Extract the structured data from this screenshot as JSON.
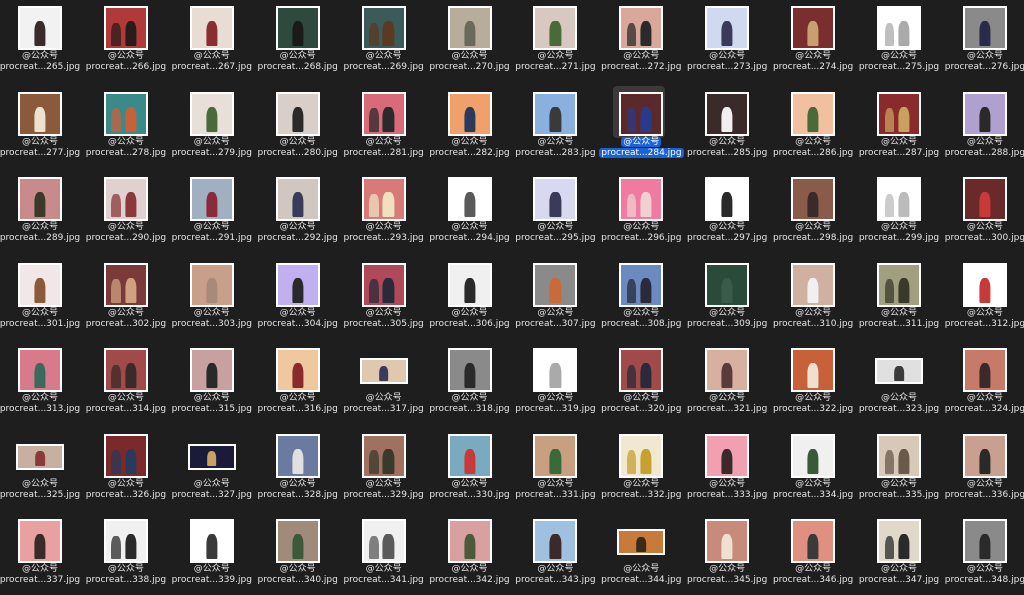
{
  "account_label": "@公众号",
  "colors": {
    "background": "#1e1e1e",
    "selection": "#1a63d6",
    "text": "#e6e6e6"
  },
  "files": [
    {
      "caption": "procreat...265.jpg",
      "bg": "#f2f2f2",
      "fig": "#3a2b2b"
    },
    {
      "caption": "procreat...266.jpg",
      "bg": "#b03a3a",
      "fig": "#2a1c18"
    },
    {
      "caption": "procreat...267.jpg",
      "bg": "#e8dcd3",
      "fig": "#8a2f2f"
    },
    {
      "caption": "procreat...268.jpg",
      "bg": "#2e4a3e",
      "fig": "#1a1a1a"
    },
    {
      "caption": "procreat...269.jpg",
      "bg": "#3d5a5a",
      "fig": "#5a3a22"
    },
    {
      "caption": "procreat...270.jpg",
      "bg": "#b8ad9a",
      "fig": "#6a6a5a"
    },
    {
      "caption": "procreat...271.jpg",
      "bg": "#d8c8c0",
      "fig": "#4a6a3a"
    },
    {
      "caption": "procreat...272.jpg",
      "bg": "#d9a89a",
      "fig": "#2a2a2a"
    },
    {
      "caption": "procreat...273.jpg",
      "bg": "#cfdaf0",
      "fig": "#3a3a5a"
    },
    {
      "caption": "procreat...274.jpg",
      "bg": "#7a2e2e",
      "fig": "#c8a070"
    },
    {
      "caption": "procreat...275.jpg",
      "bg": "#ffffff",
      "fig": "#aaaaaa"
    },
    {
      "caption": "procreat...276.jpg",
      "bg": "#8a8a8a",
      "fig": "#2a2a4a"
    },
    {
      "caption": "procreat...277.jpg",
      "bg": "#8a5a3a",
      "fig": "#f0e0d0"
    },
    {
      "caption": "procreat...278.jpg",
      "bg": "#3a8a8a",
      "fig": "#c8603a"
    },
    {
      "caption": "procreat...279.jpg",
      "bg": "#e8e0d8",
      "fig": "#4a6a3a"
    },
    {
      "caption": "procreat...280.jpg",
      "bg": "#d8d0c8",
      "fig": "#2a2a2a"
    },
    {
      "caption": "procreat...281.jpg",
      "bg": "#d86a7a",
      "fig": "#2a2a2a"
    },
    {
      "caption": "procreat...282.jpg",
      "bg": "#f0a06a",
      "fig": "#2a3a5a"
    },
    {
      "caption": "procreat...283.jpg",
      "bg": "#8ab0e0",
      "fig": "#3a3a3a"
    },
    {
      "caption": "procreat...284.jpg",
      "bg": "#5a2a2a",
      "fig": "#2a3a8a"
    },
    {
      "caption": "procreat...285.jpg",
      "bg": "#3a2a2a",
      "fig": "#f0f0f0"
    },
    {
      "caption": "procreat...286.jpg",
      "bg": "#f0c0a0",
      "fig": "#4a6a3a"
    },
    {
      "caption": "procreat...287.jpg",
      "bg": "#8a2a2a",
      "fig": "#c8a060"
    },
    {
      "caption": "procreat...288.jpg",
      "bg": "#b0a0d0",
      "fig": "#2a2a2a"
    },
    {
      "caption": "procreat...289.jpg",
      "bg": "#c88a8a",
      "fig": "#3a3a2a"
    },
    {
      "caption": "procreat...290.jpg",
      "bg": "#e0d0d0",
      "fig": "#8a3a3a"
    },
    {
      "caption": "procreat...291.jpg",
      "bg": "#a0b0c0",
      "fig": "#8a2a3a"
    },
    {
      "caption": "procreat...292.jpg",
      "bg": "#d0c8c0",
      "fig": "#3a3a5a"
    },
    {
      "caption": "procreat...293.jpg",
      "bg": "#d87a7a",
      "fig": "#f0e0c0"
    },
    {
      "caption": "procreat...294.jpg",
      "bg": "#ffffff",
      "fig": "#5a5a5a"
    },
    {
      "caption": "procreat...295.jpg",
      "bg": "#d8d8f0",
      "fig": "#3a3a5a"
    },
    {
      "caption": "procreat...296.jpg",
      "bg": "#f07aa0",
      "fig": "#f0d0d0"
    },
    {
      "caption": "procreat...297.jpg",
      "bg": "#ffffff",
      "fig": "#2a2a2a"
    },
    {
      "caption": "procreat...298.jpg",
      "bg": "#8a5a4a",
      "fig": "#3a2a2a"
    },
    {
      "caption": "procreat...299.jpg",
      "bg": "#ffffff",
      "fig": "#bbbbbb"
    },
    {
      "caption": "procreat...300.jpg",
      "bg": "#6a2a2a",
      "fig": "#c83a3a"
    },
    {
      "caption": "procreat...301.jpg",
      "bg": "#f0e8e8",
      "fig": "#8a5a3a"
    },
    {
      "caption": "procreat...302.jpg",
      "bg": "#7a3a3a",
      "fig": "#d0a080"
    },
    {
      "caption": "procreat...303.jpg",
      "bg": "#c8a08a",
      "fig": "#a88a7a"
    },
    {
      "caption": "procreat...304.jpg",
      "bg": "#c0b0f0",
      "fig": "#2a2a2a"
    },
    {
      "caption": "procreat...305.jpg",
      "bg": "#b04a5a",
      "fig": "#2a2a3a"
    },
    {
      "caption": "procreat...306.jpg",
      "bg": "#f0f0f0",
      "fig": "#2a2a2a"
    },
    {
      "caption": "procreat...307.jpg",
      "bg": "#8a8a8a",
      "fig": "#c86a3a"
    },
    {
      "caption": "procreat...308.jpg",
      "bg": "#6a8ac0",
      "fig": "#2a2a3a"
    },
    {
      "caption": "procreat...309.jpg",
      "bg": "#2a4a3a",
      "fig": "#3a5a4a"
    },
    {
      "caption": "procreat...310.jpg",
      "bg": "#d0b0a0",
      "fig": "#f0f0f0"
    },
    {
      "caption": "procreat...311.jpg",
      "bg": "#a0a080",
      "fig": "#3a3a2a"
    },
    {
      "caption": "procreat...312.jpg",
      "bg": "#ffffff",
      "fig": "#c83a3a"
    },
    {
      "caption": "procreat...313.jpg",
      "bg": "#d87a8a",
      "fig": "#3a6a5a"
    },
    {
      "caption": "procreat...314.jpg",
      "bg": "#a04a4a",
      "fig": "#3a2a2a"
    },
    {
      "caption": "procreat...315.jpg",
      "bg": "#c8a0a0",
      "fig": "#2a2a2a"
    },
    {
      "caption": "procreat...316.jpg",
      "bg": "#f0c8a0",
      "fig": "#8a2a2a"
    },
    {
      "caption": "procreat...317.jpg",
      "bg": "#e0c8b0",
      "fig": "#3a3a5a",
      "wide": true
    },
    {
      "caption": "procreat...318.jpg",
      "bg": "#8a8a8a",
      "fig": "#2a2a2a"
    },
    {
      "caption": "procreat...319.jpg",
      "bg": "#ffffff",
      "fig": "#aaaaaa"
    },
    {
      "caption": "procreat...320.jpg",
      "bg": "#a04a4a",
      "fig": "#2a2a3a"
    },
    {
      "caption": "procreat...321.jpg",
      "bg": "#d8b0a0",
      "fig": "#5a3a3a"
    },
    {
      "caption": "procreat...322.jpg",
      "bg": "#c8603a",
      "fig": "#f0e0d0"
    },
    {
      "caption": "procreat...323.jpg",
      "bg": "#e0e0e0",
      "fig": "#3a3a3a",
      "wide": true
    },
    {
      "caption": "procreat...324.jpg",
      "bg": "#c87a6a",
      "fig": "#3a2a2a"
    },
    {
      "caption": "procreat...325.jpg",
      "bg": "#c8b0a0",
      "fig": "#8a3a3a",
      "wide": true
    },
    {
      "caption": "procreat...326.jpg",
      "bg": "#7a2a2a",
      "fig": "#2a3a5a"
    },
    {
      "caption": "procreat...327.jpg",
      "bg": "#1a1a3a",
      "fig": "#c8a060",
      "wide": true
    },
    {
      "caption": "procreat...328.jpg",
      "bg": "#6a7aa0",
      "fig": "#e0e0e0"
    },
    {
      "caption": "procreat...329.jpg",
      "bg": "#a07060",
      "fig": "#3a3a2a"
    },
    {
      "caption": "procreat...330.jpg",
      "bg": "#7aaac0",
      "fig": "#c83a3a"
    },
    {
      "caption": "procreat...331.jpg",
      "bg": "#c8a080",
      "fig": "#3a6a3a"
    },
    {
      "caption": "procreat...332.jpg",
      "bg": "#f0e8d0",
      "fig": "#c8a030"
    },
    {
      "caption": "procreat...333.jpg",
      "bg": "#f0a0b0",
      "fig": "#3a2a2a"
    },
    {
      "caption": "procreat...334.jpg",
      "bg": "#f0f0f0",
      "fig": "#3a5a3a"
    },
    {
      "caption": "procreat...335.jpg",
      "bg": "#d8c8b8",
      "fig": "#6a5a4a"
    },
    {
      "caption": "procreat...336.jpg",
      "bg": "#c8a090",
      "fig": "#2a2a2a"
    },
    {
      "caption": "procreat...337.jpg",
      "bg": "#e8a0a0",
      "fig": "#3a2a2a"
    },
    {
      "caption": "procreat...338.jpg",
      "bg": "#f0f0f0",
      "fig": "#2a2a2a"
    },
    {
      "caption": "procreat...339.jpg",
      "bg": "#ffffff",
      "fig": "#3a3a3a"
    },
    {
      "caption": "procreat...340.jpg",
      "bg": "#a08a7a",
      "fig": "#3a5a3a"
    },
    {
      "caption": "procreat...341.jpg",
      "bg": "#f0f0f0",
      "fig": "#5a5a5a"
    },
    {
      "caption": "procreat...342.jpg",
      "bg": "#d8a0a0",
      "fig": "#4a5a3a"
    },
    {
      "caption": "procreat...343.jpg",
      "bg": "#a0c0e0",
      "fig": "#3a2a2a"
    },
    {
      "caption": "procreat...344.jpg",
      "bg": "#c87a3a",
      "fig": "#3a2a1a",
      "wide": true
    },
    {
      "caption": "procreat...345.jpg",
      "bg": "#c88a7a",
      "fig": "#f0e0d0"
    },
    {
      "caption": "procreat...346.jpg",
      "bg": "#e09080",
      "fig": "#3a3a3a"
    },
    {
      "caption": "procreat...347.jpg",
      "bg": "#e0d8c8",
      "fig": "#2a2a2a"
    },
    {
      "caption": "procreat...348.jpg",
      "bg": "#8a8a8a",
      "fig": "#2a2a2a"
    }
  ],
  "selected_index": 19
}
